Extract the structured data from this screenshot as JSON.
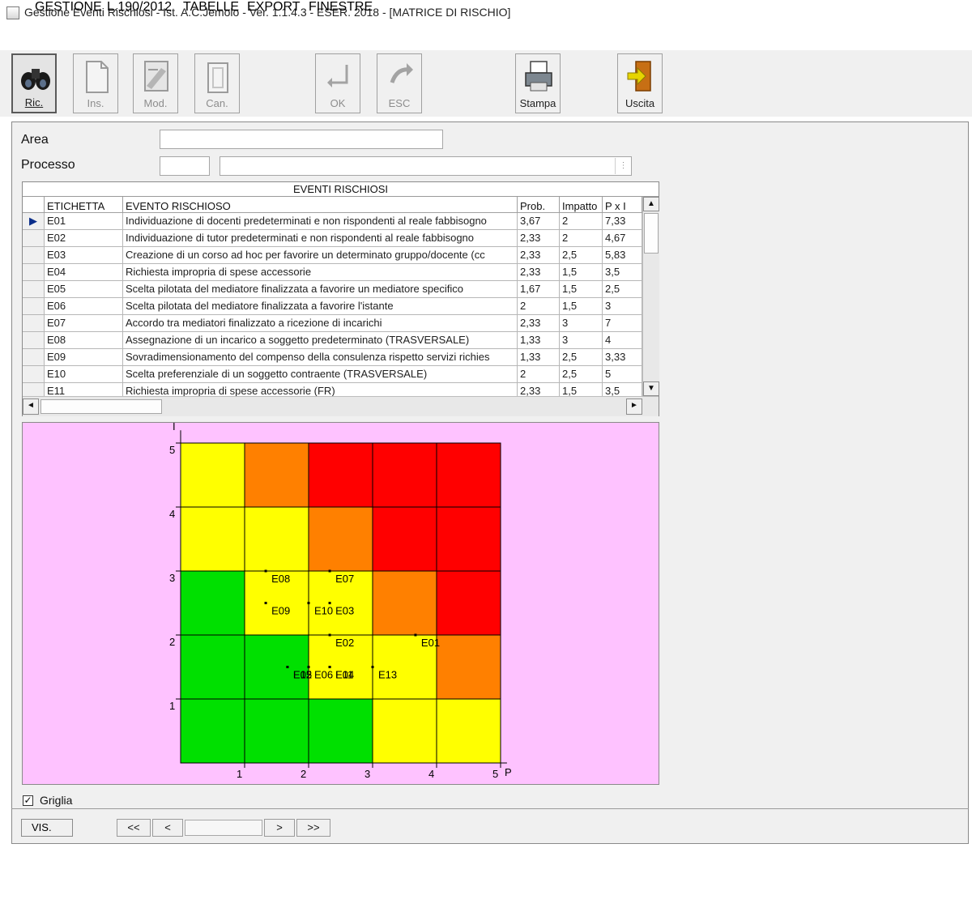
{
  "window": {
    "title": "Gestione Eventi Rischiosi - Ist. A.C.Jemolo - Ver. 1.1.4.3 - ESER. 2018 - [MATRICE DI RISCHIO]"
  },
  "menu": [
    "GESTIONE",
    "L.190/2012",
    "TABELLE",
    "EXPORT",
    "FINESTRE"
  ],
  "toolbar": {
    "buttons": [
      {
        "label": "Ric.",
        "icon": "binoculars-icon",
        "state": "pressed"
      },
      {
        "label": "Ins.",
        "icon": "new-document-icon",
        "state": "disabled"
      },
      {
        "label": "Mod.",
        "icon": "edit-document-icon",
        "state": "disabled"
      },
      {
        "label": "Can.",
        "icon": "delete-document-icon",
        "state": "disabled"
      },
      {
        "label": "OK",
        "icon": "enter-arrow-icon",
        "state": "disabled"
      },
      {
        "label": "ESC",
        "icon": "undo-arrow-icon",
        "state": "disabled"
      },
      {
        "label": "Stampa",
        "icon": "printer-icon",
        "state": "enabled"
      },
      {
        "label": "Uscita",
        "icon": "exit-door-icon",
        "state": "enabled"
      }
    ]
  },
  "form": {
    "area_label": "Area",
    "area_value": "",
    "processo_label": "Processo",
    "processo_code": "",
    "processo_desc": ""
  },
  "grid": {
    "caption": "EVENTI RISCHIOSI",
    "columns": [
      "ETICHETTA",
      "EVENTO  RISCHIOSO",
      "Prob.",
      "Impatto",
      "P x I"
    ],
    "rows": [
      [
        "E01",
        "Individuazione di docenti predeterminati e non rispondenti al reale fabbisogno",
        "3,67",
        "2",
        "7,33"
      ],
      [
        "E02",
        "Individuazione di tutor predeterminati e non rispondenti al reale fabbisogno",
        "2,33",
        "2",
        "4,67"
      ],
      [
        "E03",
        "Creazione di un corso ad hoc per favorire un determinato gruppo/docente (cc",
        "2,33",
        "2,5",
        "5,83"
      ],
      [
        "E04",
        "Richiesta impropria di spese accessorie",
        "2,33",
        "1,5",
        "3,5"
      ],
      [
        "E05",
        "Scelta pilotata del mediatore finalizzata a favorire un mediatore specifico",
        "1,67",
        "1,5",
        "2,5"
      ],
      [
        "E06",
        "Scelta pilotata del mediatore finalizzata a favorire l'istante",
        "2",
        "1,5",
        "3"
      ],
      [
        "E07",
        "Accordo tra mediatori finalizzato a ricezione di incarichi",
        "2,33",
        "3",
        "7"
      ],
      [
        "E08",
        "Assegnazione di un incarico a soggetto predeterminato (TRASVERSALE)",
        "1,33",
        "3",
        "4"
      ],
      [
        "E09",
        "Sovradimensionamento del compenso della consulenza rispetto servizi richies",
        "1,33",
        "2,5",
        "3,33"
      ],
      [
        "E10",
        "Scelta preferenziale di un soggetto contraente (TRASVERSALE)",
        "2",
        "2,5",
        "5"
      ],
      [
        "E11",
        "Richiesta impropria di spese accessorie (FR)",
        "2,33",
        "1,5",
        "3,5"
      ]
    ]
  },
  "chart_data": {
    "type": "scatter",
    "xlabel": "P",
    "ylabel": "I",
    "xlim": [
      0,
      5
    ],
    "ylim": [
      0,
      5
    ],
    "x_ticks": [
      "1",
      "2",
      "3",
      "4",
      "5"
    ],
    "y_ticks": [
      "1",
      "2",
      "3",
      "4",
      "5"
    ],
    "grid": true,
    "cell_colors": [
      [
        "#ffff00",
        "#ff8000",
        "#ff0000",
        "#ff0000",
        "#ff0000"
      ],
      [
        "#ffff00",
        "#ffff00",
        "#ff8000",
        "#ff0000",
        "#ff0000"
      ],
      [
        "#00e000",
        "#ffff00",
        "#ffff00",
        "#ff8000",
        "#ff0000"
      ],
      [
        "#00e000",
        "#00e000",
        "#ffff00",
        "#ffff00",
        "#ff8000"
      ],
      [
        "#00e000",
        "#00e000",
        "#00e000",
        "#ffff00",
        "#ffff00"
      ]
    ],
    "points": [
      {
        "label": "E01",
        "x": 3.67,
        "y": 2
      },
      {
        "label": "E02",
        "x": 2.33,
        "y": 2
      },
      {
        "label": "E03",
        "x": 2.33,
        "y": 2.5
      },
      {
        "label": "E04",
        "x": 2.33,
        "y": 1.5
      },
      {
        "label": "E05",
        "x": 1.67,
        "y": 1.5
      },
      {
        "label": "E06",
        "x": 2,
        "y": 1.5
      },
      {
        "label": "E07",
        "x": 2.33,
        "y": 3
      },
      {
        "label": "E08",
        "x": 1.33,
        "y": 3
      },
      {
        "label": "E09",
        "x": 1.33,
        "y": 2.5
      },
      {
        "label": "E10",
        "x": 2,
        "y": 2.5
      },
      {
        "label": "E11",
        "x": 2.33,
        "y": 1.5
      },
      {
        "label": "E12",
        "x": 1.67,
        "y": 1.5
      },
      {
        "label": "E13",
        "x": 3,
        "y": 1.5
      }
    ]
  },
  "options": {
    "griglia_label": "Griglia",
    "griglia_checked": "✓"
  },
  "nav": {
    "vis_label": "VIS.",
    "first": "<<",
    "prev": "<",
    "next": ">",
    "last": ">>"
  },
  "scroll": {
    "up": "▲",
    "down": "▼",
    "left": "◄",
    "right": "►"
  }
}
